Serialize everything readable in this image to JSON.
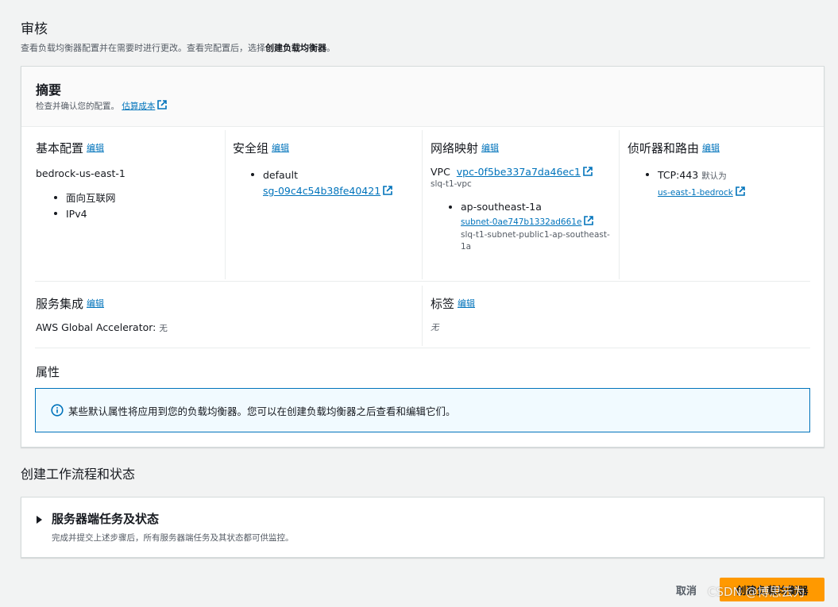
{
  "page": {
    "title": "审核",
    "description_prefix": "查看负载均衡器配置并在需要时进行更改。查看完配置后，选择",
    "description_bold": "创建负载均衡器",
    "description_suffix": "。"
  },
  "summary": {
    "title": "摘要",
    "description": "检查并确认您的配置。",
    "estimate_link": "估算成本"
  },
  "edit_label": "编辑",
  "basic": {
    "title": "基本配置",
    "name": "bedrock-us-east-1",
    "items": [
      "面向互联网",
      "IPv4"
    ]
  },
  "security_groups": {
    "title": "安全组",
    "name": "default",
    "id": "sg-09c4c54b38fe40421"
  },
  "network": {
    "title": "网络映射",
    "vpc_label": "VPC",
    "vpc_id": "vpc-0f5be337a7da46ec1",
    "vpc_name": "slq-t1-vpc",
    "az": "ap-southeast-1a",
    "subnet_id": "subnet-0ae747b1332ad661e",
    "subnet_name": "slq-t1-subnet-public1-ap-southeast-1a"
  },
  "listeners": {
    "title": "侦听器和路由",
    "listener": "TCP:443",
    "default_label": "默认为",
    "target": "us-east-1-bedrock"
  },
  "integrations": {
    "title": "服务集成",
    "label": "AWS Global Accelerator:",
    "value": "无"
  },
  "tags": {
    "title": "标签",
    "value": "无"
  },
  "attributes": {
    "title": "属性",
    "info": "某些默认属性将应用到您的负载均衡器。您可以在创建负载均衡器之后查看和编辑它们。"
  },
  "workflow": {
    "section_title": "创建工作流程和状态",
    "title": "服务器端任务及状态",
    "description": "完成并提交上述步骤后，所有服务器端任务及其状态都可供监控。"
  },
  "actions": {
    "cancel": "取消",
    "create": "创建负载均衡器"
  },
  "watermark": "CSDN @博思云为",
  "colors": {
    "link": "#0073bb",
    "primary_button": "#ff9900",
    "info_border": "#0073bb"
  }
}
